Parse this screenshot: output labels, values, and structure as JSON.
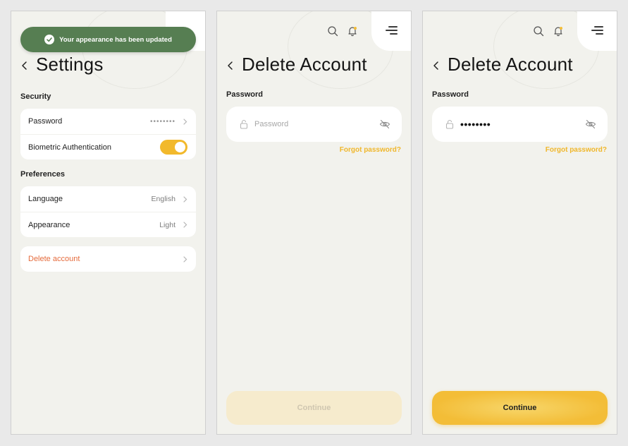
{
  "screen1": {
    "toast": "Your appearance has been updated",
    "title": "Settings",
    "security_label": "Security",
    "security_items": [
      {
        "label": "Password",
        "value": "••••••••"
      },
      {
        "label": "Biometric Authentication",
        "toggle_on": true
      }
    ],
    "preferences_label": "Preferences",
    "preference_items": [
      {
        "label": "Language",
        "value": "English"
      },
      {
        "label": "Appearance",
        "value": "Light"
      }
    ],
    "delete_label": "Delete account"
  },
  "screen2": {
    "title": "Delete Account",
    "password_label": "Password",
    "password_placeholder": "Password",
    "forgot_label": "Forgot password?",
    "continue_label": "Continue"
  },
  "screen3": {
    "title": "Delete Account",
    "password_label": "Password",
    "password_value": "••••••••",
    "forgot_label": "Forgot password?",
    "continue_label": "Continue"
  },
  "colors": {
    "accent": "#f3bd37",
    "toast": "#567e52",
    "danger": "#e56b3c",
    "background": "#f2f2ed"
  },
  "icons": [
    "check-icon",
    "back-arrow-icon",
    "chevron-right-icon",
    "search-icon",
    "bell-icon",
    "menu-icon",
    "lock-icon",
    "eye-off-icon"
  ]
}
